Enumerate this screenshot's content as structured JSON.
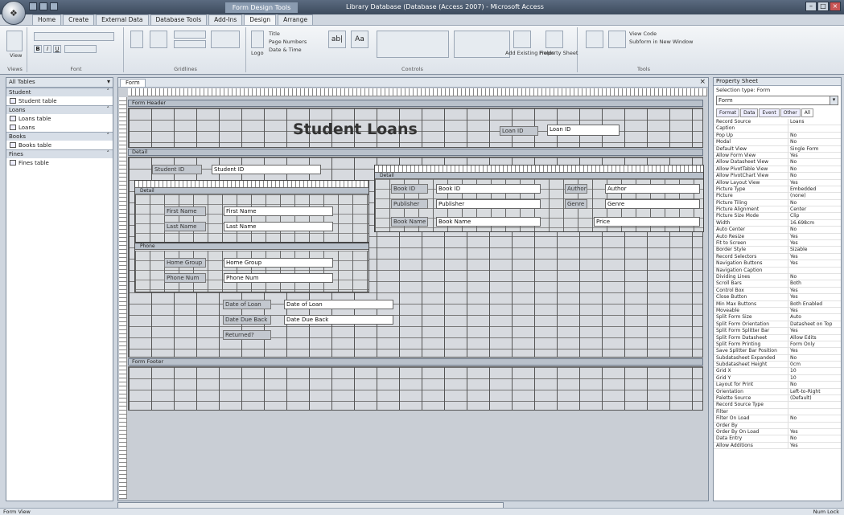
{
  "window": {
    "title": "Library Database (Database (Access 2007) - Microsoft Access",
    "context_tab": "Form Design Tools",
    "controls": [
      "–",
      "□",
      "×"
    ]
  },
  "ribbon": {
    "tabs": [
      "Home",
      "Create",
      "External Data",
      "Database Tools",
      "Add-Ins",
      "Design",
      "Arrange"
    ],
    "active_tab": "Design",
    "groups": [
      {
        "label": "Views",
        "buttons": [
          "View"
        ]
      },
      {
        "label": "Font",
        "buttons": [
          "B",
          "I",
          "U"
        ]
      },
      {
        "label": "Gridlines",
        "buttons": [
          "Gridlines"
        ]
      },
      {
        "label": "Controls",
        "buttons": [
          "Logo",
          "Title",
          "Page Numbers",
          "Date & Time",
          "Add Existing Fields",
          "Property Sheet"
        ]
      },
      {
        "label": "Tools",
        "buttons": [
          "Subform in New Window",
          "View Code"
        ]
      }
    ],
    "controls_label": "Controls",
    "tools_label": "Tools",
    "add_existing": "Add Existing Fields",
    "property_sheet": "Property Sheet",
    "title_btn": "Title",
    "logo_btn": "Logo",
    "date_btn": "Date & Time",
    "page_btn": "Page Numbers",
    "view_code": "View Code",
    "subform_new": "Subform in New Window"
  },
  "nav_pane": {
    "header": "All Tables",
    "groups": [
      {
        "name": "Student",
        "items": [
          "Student table"
        ]
      },
      {
        "name": "Loans",
        "items": [
          "Loans table",
          "Loans"
        ]
      },
      {
        "name": "Books",
        "items": [
          "Books table"
        ]
      },
      {
        "name": "Fines",
        "items": [
          "Fines table"
        ]
      }
    ]
  },
  "document": {
    "tab": "Form",
    "sections": {
      "form_header": "Form Header",
      "detail": "Detail",
      "form_footer": "Form Footer"
    },
    "title": "Student Loans",
    "loan_id_label": "Loan ID",
    "loan_id_value": "Loan ID",
    "student_id_label": "Student ID",
    "student_id_value": "Student ID",
    "subform_detail_label": "Detail",
    "first_name_label": "First Name",
    "first_name_value": "First Name",
    "last_name_label": "Last Name",
    "last_name_value": "Last Name",
    "phone_label": "Phone",
    "home_group_label": "Home Group",
    "home_group_value": "Home Group",
    "phone_num_label": "Phone Num",
    "phone_num_value": "Phone Num",
    "date_of_loan_label": "Date of Loan",
    "date_of_loan_value": "Date of Loan",
    "date_due_back_label": "Date Due Back",
    "date_due_back_value": "Date Due Back",
    "returned_label": "Returned?",
    "books_subform_label": "Detail",
    "book_id_label": "Book ID",
    "book_id_value": "Book ID",
    "author_label": "Author",
    "author_value": "Author",
    "publisher_label": "Publisher",
    "publisher_value": "Publisher",
    "genre_label": "Genre",
    "genre_value": "Genre",
    "book_name_label": "Book Name",
    "book_name_value": "Book Name",
    "price_value": "Price"
  },
  "property_sheet": {
    "title": "Property Sheet",
    "selection_type": "Selection type: Form",
    "selected": "Form",
    "tabs": [
      "Format",
      "Data",
      "Event",
      "Other",
      "All"
    ],
    "active_tab": "All",
    "rows": [
      [
        "Record Source",
        "Loans"
      ],
      [
        "Caption",
        ""
      ],
      [
        "Pop Up",
        "No"
      ],
      [
        "Modal",
        "No"
      ],
      [
        "Default View",
        "Single Form"
      ],
      [
        "Allow Form View",
        "Yes"
      ],
      [
        "Allow Datasheet View",
        "No"
      ],
      [
        "Allow PivotTable View",
        "No"
      ],
      [
        "Allow PivotChart View",
        "No"
      ],
      [
        "Allow Layout View",
        "Yes"
      ],
      [
        "Picture Type",
        "Embedded"
      ],
      [
        "Picture",
        "(none)"
      ],
      [
        "Picture Tiling",
        "No"
      ],
      [
        "Picture Alignment",
        "Center"
      ],
      [
        "Picture Size Mode",
        "Clip"
      ],
      [
        "Width",
        "16.698cm"
      ],
      [
        "Auto Center",
        "No"
      ],
      [
        "Auto Resize",
        "Yes"
      ],
      [
        "Fit to Screen",
        "Yes"
      ],
      [
        "Border Style",
        "Sizable"
      ],
      [
        "Record Selectors",
        "Yes"
      ],
      [
        "Navigation Buttons",
        "Yes"
      ],
      [
        "Navigation Caption",
        ""
      ],
      [
        "Dividing Lines",
        "No"
      ],
      [
        "Scroll Bars",
        "Both"
      ],
      [
        "Control Box",
        "Yes"
      ],
      [
        "Close Button",
        "Yes"
      ],
      [
        "Min Max Buttons",
        "Both Enabled"
      ],
      [
        "Moveable",
        "Yes"
      ],
      [
        "Split Form Size",
        "Auto"
      ],
      [
        "Split Form Orientation",
        "Datasheet on Top"
      ],
      [
        "Split Form Splitter Bar",
        "Yes"
      ],
      [
        "Split Form Datasheet",
        "Allow Edits"
      ],
      [
        "Split Form Printing",
        "Form Only"
      ],
      [
        "Save Splitter Bar Position",
        "Yes"
      ],
      [
        "Subdatasheet Expanded",
        "No"
      ],
      [
        "Subdatasheet Height",
        "0cm"
      ],
      [
        "Grid X",
        "10"
      ],
      [
        "Grid Y",
        "10"
      ],
      [
        "Layout for Print",
        "No"
      ],
      [
        "Orientation",
        "Left-to-Right"
      ],
      [
        "Palette Source",
        "(Default)"
      ],
      [
        "Record Source Type",
        ""
      ],
      [
        "Filter",
        ""
      ],
      [
        "Filter On Load",
        "No"
      ],
      [
        "Order By",
        ""
      ],
      [
        "Order By On Load",
        "Yes"
      ],
      [
        "Data Entry",
        "No"
      ],
      [
        "Allow Additions",
        "Yes"
      ]
    ]
  },
  "status_bar": {
    "left": "Form View",
    "right": "Num Lock"
  }
}
